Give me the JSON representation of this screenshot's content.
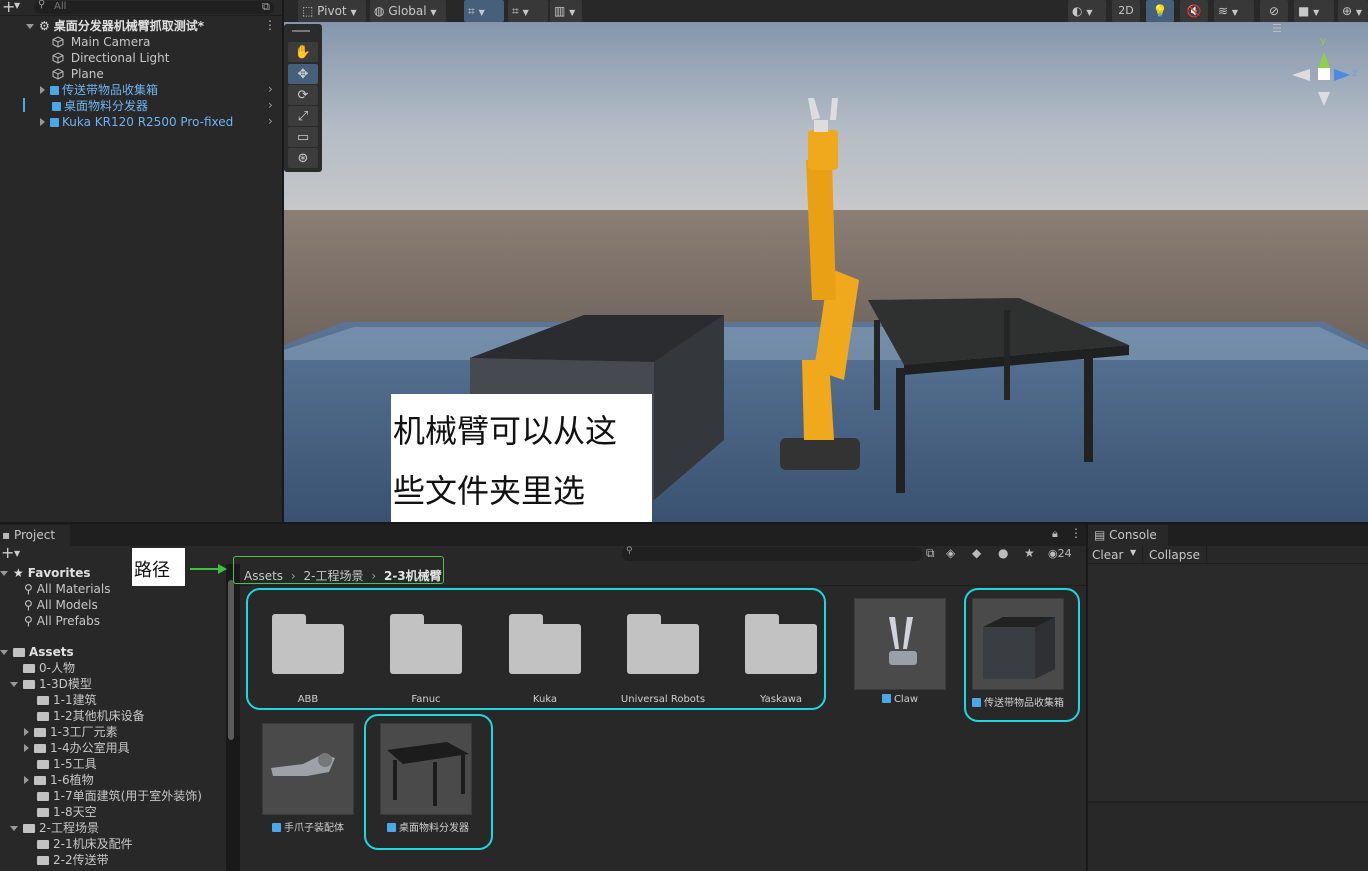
{
  "hierarchy": {
    "search_placeholder": "All",
    "scene_title": "桌面分发器机械臂抓取测试*",
    "items": [
      {
        "label": "Main Camera",
        "prefab": false
      },
      {
        "label": "Directional Light",
        "prefab": false
      },
      {
        "label": "Plane",
        "prefab": false
      },
      {
        "label": "传送带物品收集箱",
        "prefab": true
      },
      {
        "label": "桌面物料分发器",
        "prefab": true
      },
      {
        "label": "Kuka KR120 R2500 Pro-fixed",
        "prefab": true
      }
    ]
  },
  "scene_toolbar": {
    "pivot": "Pivot",
    "global": "Global",
    "mode_2d": "2D"
  },
  "gizmo": {
    "y": "y",
    "z": "z"
  },
  "annotation": {
    "callout_line1": "机械臂可以从这",
    "callout_line2": "些文件夹里选",
    "path_label": "路径"
  },
  "project": {
    "tab_label": "Project",
    "favorites_label": "Favorites",
    "favorites": [
      "All Materials",
      "All Models",
      "All Prefabs"
    ],
    "assets_label": "Assets",
    "tree": [
      {
        "label": "0-人物",
        "indent": 1,
        "arrow": "none"
      },
      {
        "label": "1-3D模型",
        "indent": 1,
        "arrow": "down"
      },
      {
        "label": "1-1建筑",
        "indent": 2,
        "arrow": "none"
      },
      {
        "label": "1-2其他机床设备",
        "indent": 2,
        "arrow": "none"
      },
      {
        "label": "1-3工厂元素",
        "indent": 2,
        "arrow": "right"
      },
      {
        "label": "1-4办公室用具",
        "indent": 2,
        "arrow": "right"
      },
      {
        "label": "1-5工具",
        "indent": 2,
        "arrow": "none"
      },
      {
        "label": "1-6植物",
        "indent": 2,
        "arrow": "right"
      },
      {
        "label": "1-7单面建筑(用于室外装饰)",
        "indent": 2,
        "arrow": "none"
      },
      {
        "label": "1-8天空",
        "indent": 2,
        "arrow": "none"
      },
      {
        "label": "2-工程场景",
        "indent": 1,
        "arrow": "down"
      },
      {
        "label": "2-1机床及配件",
        "indent": 2,
        "arrow": "none"
      },
      {
        "label": "2-2传送带",
        "indent": 2,
        "arrow": "none"
      }
    ],
    "breadcrumb": [
      "Assets",
      "2-工程场景",
      "2-3机械臂"
    ],
    "hidden_count": "24",
    "folders": [
      "ABB",
      "Fanuc",
      "Kuka",
      "Universal Robots",
      "Yaskawa"
    ],
    "prefabs": [
      "Claw",
      "传送带物品收集箱",
      "手爪子装配体",
      "桌面物料分发器"
    ]
  },
  "console": {
    "tab_label": "Console",
    "clear_label": "Clear",
    "collapse_label": "Collapse"
  },
  "colors": {
    "highlight": "#1fd7e0",
    "selected_text": "#6fb3f0",
    "robot": "#f0a81c",
    "panel": "#282828"
  }
}
